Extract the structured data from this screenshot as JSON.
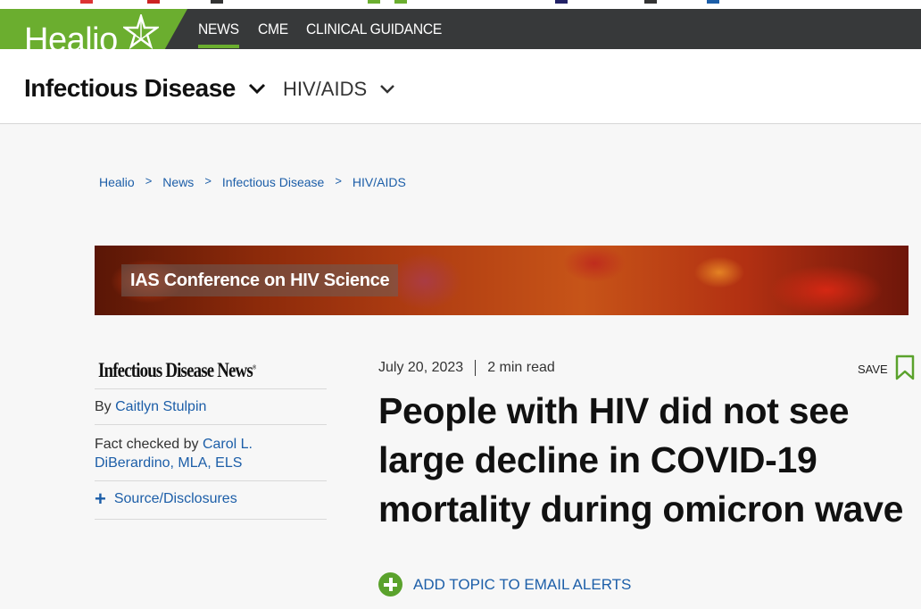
{
  "brand": {
    "logo_text": "Healio",
    "accent": "#6bae2f",
    "nav_bg": "#37393a",
    "link_color": "#1c5ea8"
  },
  "topnav": {
    "items": [
      {
        "label": "NEWS"
      },
      {
        "label": "CME"
      },
      {
        "label": "CLINICAL GUIDANCE"
      }
    ]
  },
  "subnav": {
    "primary": "Infectious Disease",
    "secondary": "HIV/AIDS"
  },
  "breadcrumb": [
    "Healio",
    "News",
    "Infectious Disease",
    "HIV/AIDS"
  ],
  "banner": {
    "label": "IAS Conference on HIV Science"
  },
  "sidebar": {
    "publication": "Infectious Disease News",
    "trademark": "®",
    "by_label": "By",
    "author": "Caitlyn Stulpin",
    "fact_label": "Fact checked by",
    "fact_checker": "Carol L. DiBerardino, MLA, ELS",
    "source_label": "Source/Disclosures"
  },
  "article": {
    "date": "July 20, 2023",
    "read_time": "2 min read",
    "save_label": "SAVE",
    "headline": "People with HIV did not see large decline in COVID-19 mortality during omicron wave",
    "alert_label": "ADD TOPIC TO EMAIL ALERTS"
  },
  "icons": [
    "star-logo-icon",
    "chevron-down-icon",
    "bookmark-icon",
    "plus-icon",
    "plus-circle-icon"
  ]
}
